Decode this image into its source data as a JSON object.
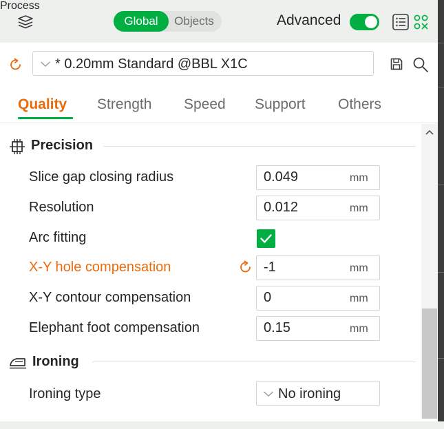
{
  "header": {
    "title": "Process",
    "mode_options": [
      "Global",
      "Objects"
    ],
    "mode_selected": "Global",
    "advanced_label": "Advanced",
    "advanced_enabled": true
  },
  "preset": {
    "name": "* 0.20mm Standard @BBL X1C"
  },
  "tabs": [
    {
      "label": "Quality",
      "active": true
    },
    {
      "label": "Strength",
      "active": false
    },
    {
      "label": "Speed",
      "active": false
    },
    {
      "label": "Support",
      "active": false
    },
    {
      "label": "Others",
      "active": false
    }
  ],
  "sections": [
    {
      "title": "Precision",
      "icon": "precision-icon",
      "rows": [
        {
          "label": "Slice gap closing radius",
          "value": "0.049",
          "unit": "mm"
        },
        {
          "label": "Resolution",
          "value": "0.012",
          "unit": "mm"
        },
        {
          "label": "Arc fitting",
          "checked": true
        },
        {
          "label": "X-Y hole compensation",
          "value": "-1",
          "unit": "mm",
          "modified": true
        },
        {
          "label": "X-Y contour compensation",
          "value": "0",
          "unit": "mm"
        },
        {
          "label": "Elephant foot compensation",
          "value": "0.15",
          "unit": "mm"
        }
      ]
    },
    {
      "title": "Ironing",
      "icon": "ironing-icon",
      "rows": [
        {
          "label": "Ironing type",
          "value": "No ironing"
        }
      ]
    }
  ],
  "colors": {
    "accent": "#00ae42",
    "modified": "#ea6b0c"
  }
}
